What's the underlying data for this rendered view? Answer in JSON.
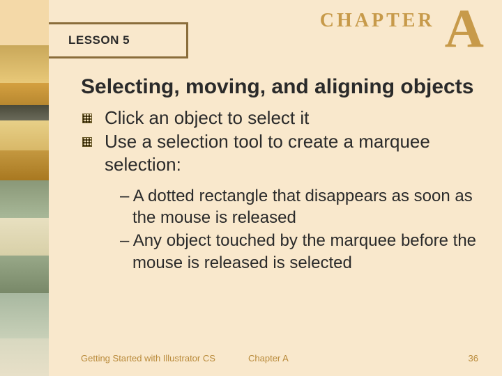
{
  "lesson_label": "LESSON 5",
  "chapter_word": "CHAPTER",
  "chapter_letter": "A",
  "title": "Selecting, moving, and aligning objects",
  "bullets": [
    "Click an object to select it",
    "Use a selection tool to create a marquee selection:"
  ],
  "sub_bullets": [
    "A dotted rectangle that disappears as soon as the mouse is released",
    "Any object touched by the marquee before the mouse is released is selected"
  ],
  "footer": {
    "left": "Getting Started with Illustrator CS",
    "center": "Chapter A",
    "right": "36"
  }
}
